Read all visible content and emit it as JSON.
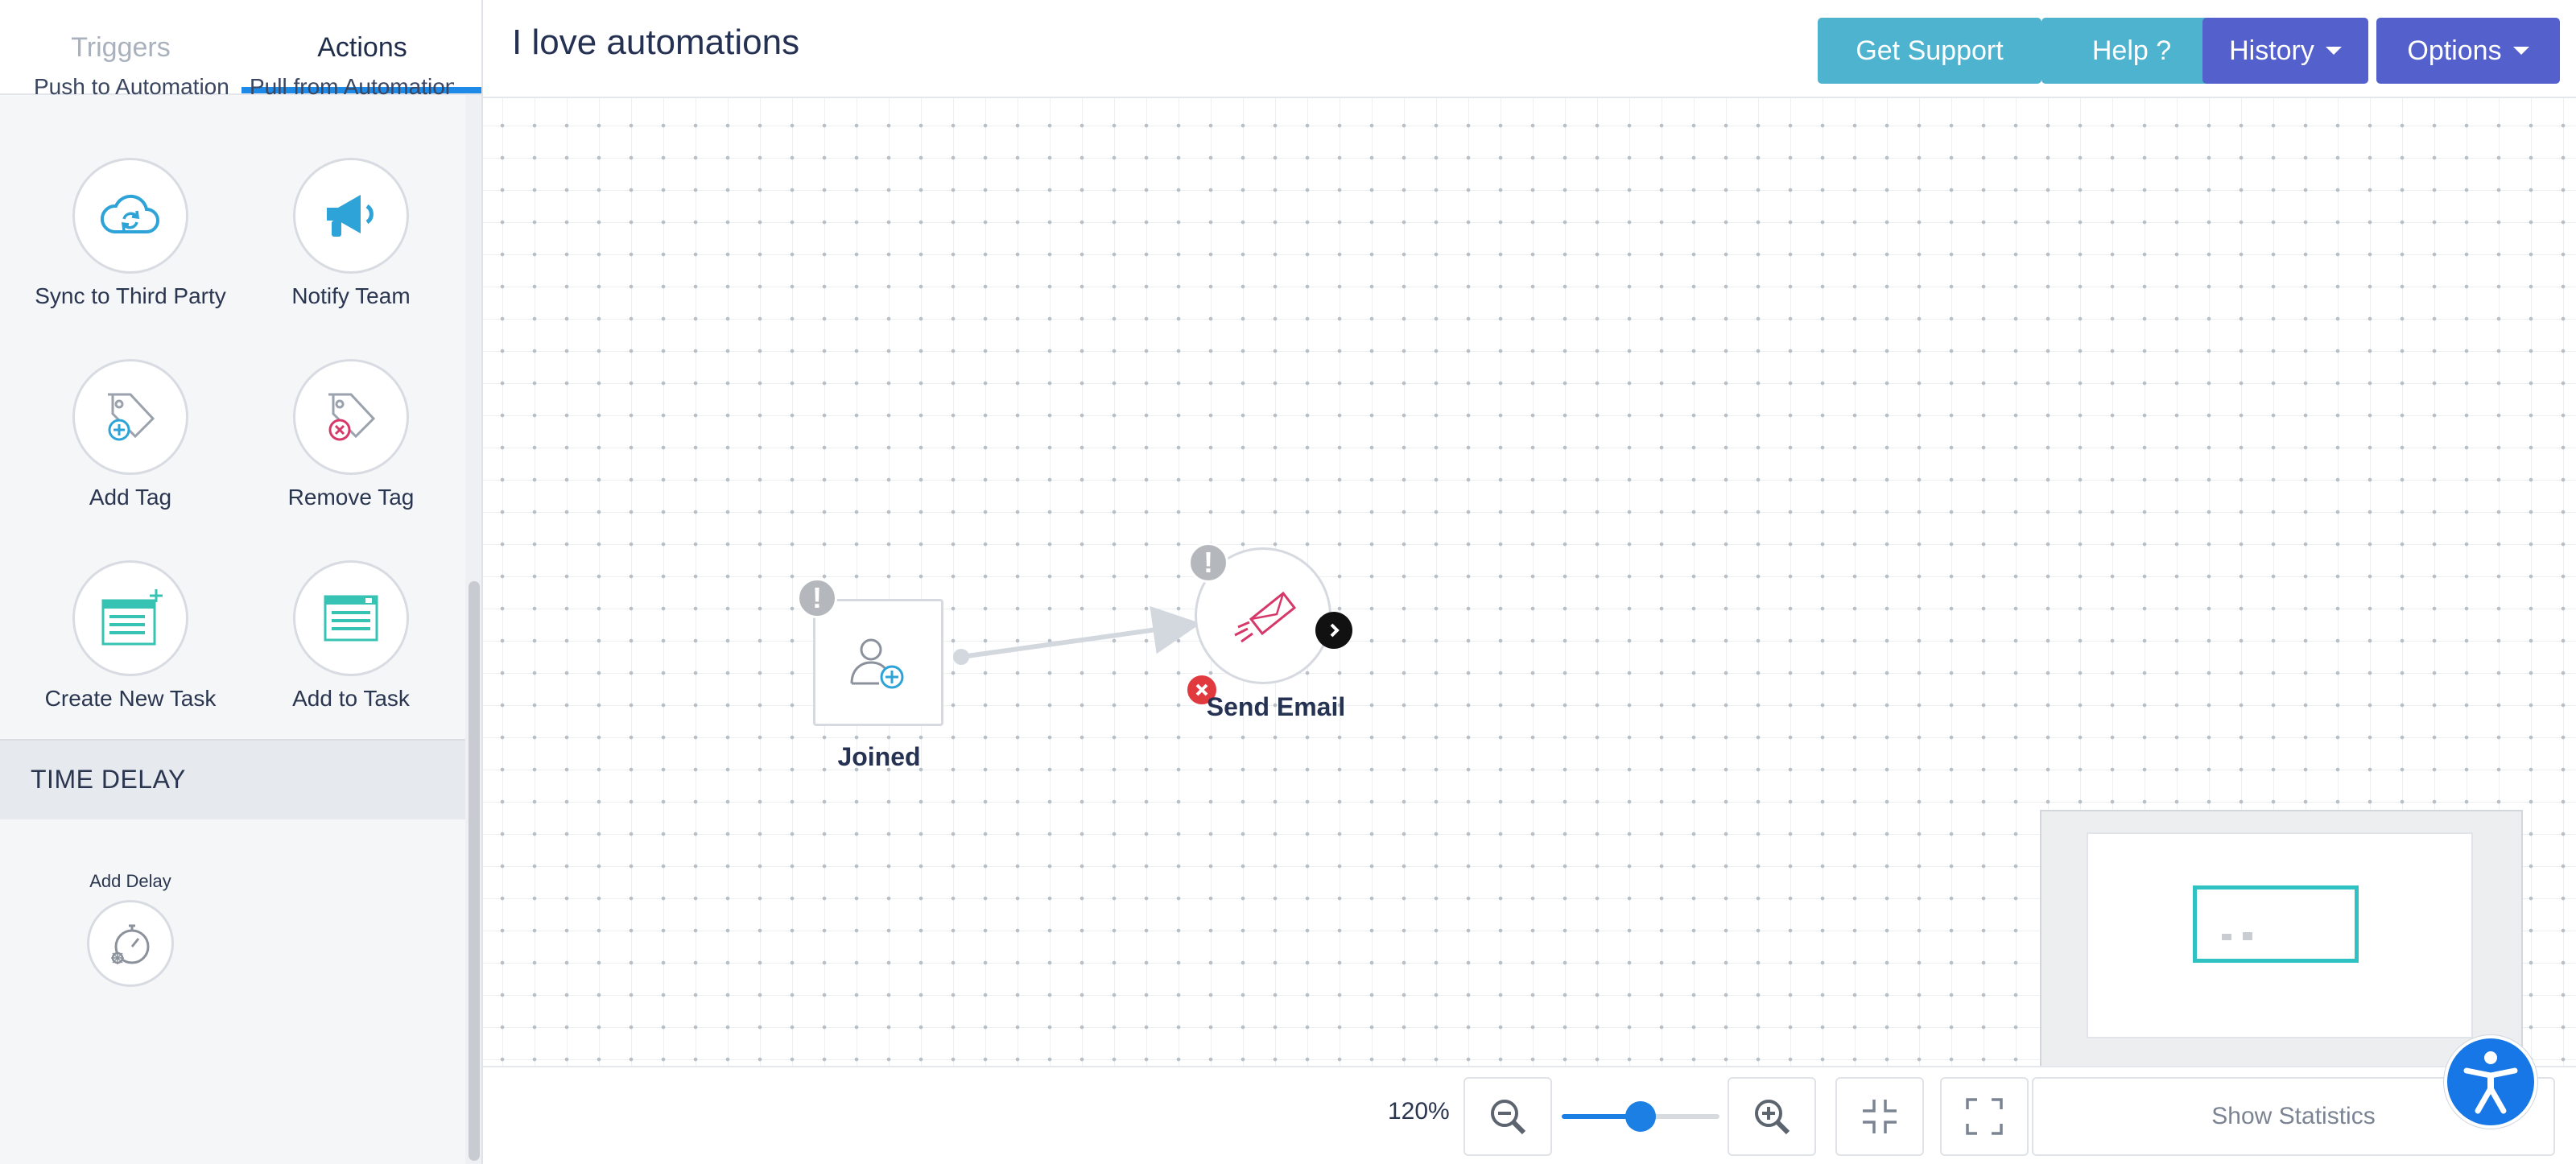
{
  "tabs": {
    "triggers": "Triggers",
    "actions": "Actions"
  },
  "clipped": {
    "left": "Push to Automation",
    "right": "Pull from Automation"
  },
  "actions": [
    {
      "label": "Sync to Third Party",
      "icon": "cloud-sync-icon"
    },
    {
      "label": "Notify Team",
      "icon": "megaphone-icon"
    },
    {
      "label": "Add Tag",
      "icon": "tag-add-icon"
    },
    {
      "label": "Remove Tag",
      "icon": "tag-remove-icon"
    },
    {
      "label": "Create New Task",
      "icon": "task-create-icon"
    },
    {
      "label": "Add to Task",
      "icon": "task-add-icon"
    }
  ],
  "section": {
    "time_delay": "TIME DELAY"
  },
  "delay": {
    "label": "Add Delay"
  },
  "header": {
    "title": "I love automations",
    "support": "Get Support",
    "help": "Help ?",
    "history": "History",
    "options": "Options"
  },
  "nodes": {
    "joined": "Joined",
    "send_email": "Send Email",
    "warning_mark": "!"
  },
  "footer": {
    "zoom_level": "120%",
    "zoom_fraction": 0.5,
    "show_statistics": "Show Statistics"
  },
  "colors": {
    "accent_blue": "#1c7fe3",
    "support_teal": "#4db3cf",
    "history_indigo": "#5461cc",
    "email_pink": "#d6386a",
    "tag_remove_red": "#d6386a",
    "task_teal": "#36c3b4",
    "minimap_cyan": "#30c2c3"
  }
}
